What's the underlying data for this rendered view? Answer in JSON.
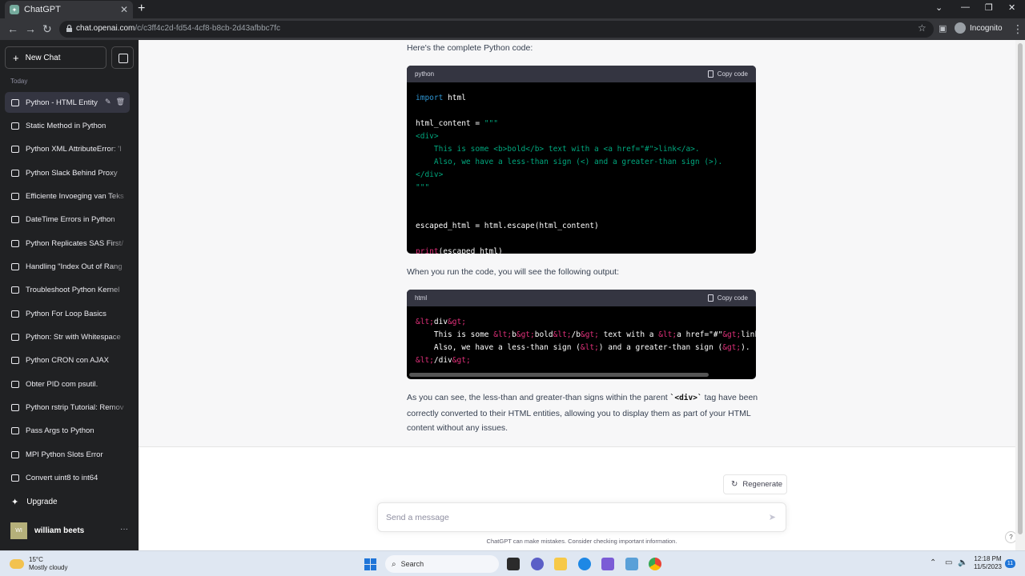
{
  "browser": {
    "tab_title": "ChatGPT",
    "url_domain": "chat.openai.com",
    "url_path": "/c/c3ff4c2d-fd54-4cf8-b8cb-2d43afbbc7fc",
    "incognito_label": "Incognito"
  },
  "sidebar": {
    "new_chat": "New Chat",
    "section_label": "Today",
    "items": [
      "Python - HTML Entity",
      "Static Method in Python",
      "Python XML AttributeError: 'I",
      "Python Slack Behind Proxy",
      "Efficiente Invoeging van Teks",
      "DateTime Errors in Python",
      "Python Replicates SAS First/",
      "Handling \"Index Out of Rang",
      "Troubleshoot Python Kernel",
      "Python For Loop Basics",
      "Python: Str with Whitespace",
      "Python CRON con AJAX",
      "Obter PID com psutil.",
      "Python rstrip Tutorial: Remov",
      "Pass Args to Python",
      "MPI Python Slots Error",
      "Convert uint8 to int64"
    ],
    "upgrade": "Upgrade",
    "user_initials": "WI",
    "user_name": "william beets"
  },
  "conversation": {
    "intro": "Here's the complete Python code:",
    "code1_lang": "python",
    "copy_label": "Copy code",
    "mid_text": "When you run the code, you will see the following output:",
    "code2_lang": "html",
    "outro_before": "As you can see, the less-than and greater-than signs within the parent ",
    "outro_code": "`<div>`",
    "outro_after": " tag have been correctly converted to their HTML entities, allowing you to display them as part of your HTML content without any issues."
  },
  "composer": {
    "regenerate": "Regenerate",
    "placeholder": "Send a message",
    "disclaimer": "ChatGPT can make mistakes. Consider checking important information."
  },
  "taskbar": {
    "temperature": "15°C",
    "weather": "Mostly cloudy",
    "search": "Search",
    "time": "12:18 PM",
    "date": "11/5/2023",
    "notifications": "11"
  }
}
